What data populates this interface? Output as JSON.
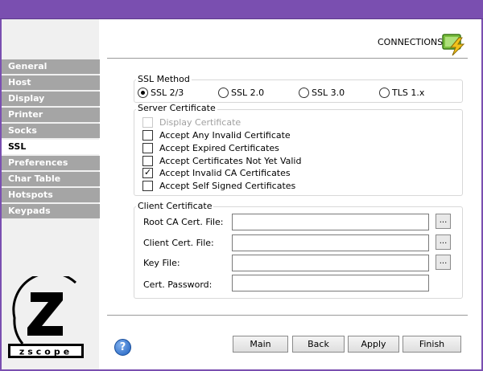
{
  "header": {
    "connections_label": "CONNECTIONS",
    "connections_icon": "connections-bolt-icon"
  },
  "sidebar": {
    "items": [
      {
        "label": "General",
        "active": false
      },
      {
        "label": "Host",
        "active": false
      },
      {
        "label": "Display",
        "active": false
      },
      {
        "label": "Printer",
        "active": false
      },
      {
        "label": "Socks",
        "active": false
      },
      {
        "label": "SSL",
        "active": true
      },
      {
        "label": "Preferences",
        "active": false
      },
      {
        "label": "Char Table",
        "active": false
      },
      {
        "label": "Hotspots",
        "active": false
      },
      {
        "label": "Keypads",
        "active": false
      }
    ],
    "logo_text": "zscope"
  },
  "ssl_method": {
    "title": "SSL Method",
    "options": [
      {
        "label": "SSL 2/3",
        "selected": true
      },
      {
        "label": "SSL 2.0",
        "selected": false
      },
      {
        "label": "SSL 3.0",
        "selected": false
      },
      {
        "label": "TLS 1.x",
        "selected": false
      }
    ]
  },
  "server_certificate": {
    "title": "Server Certificate",
    "options": [
      {
        "label": "Display Certificate",
        "checked": false,
        "disabled": true
      },
      {
        "label": "Accept Any Invalid Certificate",
        "checked": false,
        "disabled": false
      },
      {
        "label": "Accept Expired Certificates",
        "checked": false,
        "disabled": false
      },
      {
        "label": "Accept Certificates Not Yet Valid",
        "checked": false,
        "disabled": false
      },
      {
        "label": "Accept Invalid CA Certificates",
        "checked": true,
        "disabled": false
      },
      {
        "label": "Accept Self Signed Certificates",
        "checked": false,
        "disabled": false
      }
    ]
  },
  "client_certificate": {
    "title": "Client Certificate",
    "fields": [
      {
        "label": "Root CA Cert. File:",
        "value": "",
        "browse": "..."
      },
      {
        "label": "Client Cert. File:",
        "value": "",
        "browse": "..."
      },
      {
        "label": "Key File:",
        "value": "",
        "browse": "..."
      },
      {
        "label": "Cert. Password:",
        "value": ""
      }
    ]
  },
  "footer": {
    "help_label": "?",
    "buttons": {
      "main": "Main",
      "back": "Back",
      "apply": "Apply",
      "finish": "Finish"
    }
  },
  "colors": {
    "frame": "#7a4fb0",
    "nav_inactive": "#a5a5a5",
    "nav_active": "#ffffff"
  }
}
